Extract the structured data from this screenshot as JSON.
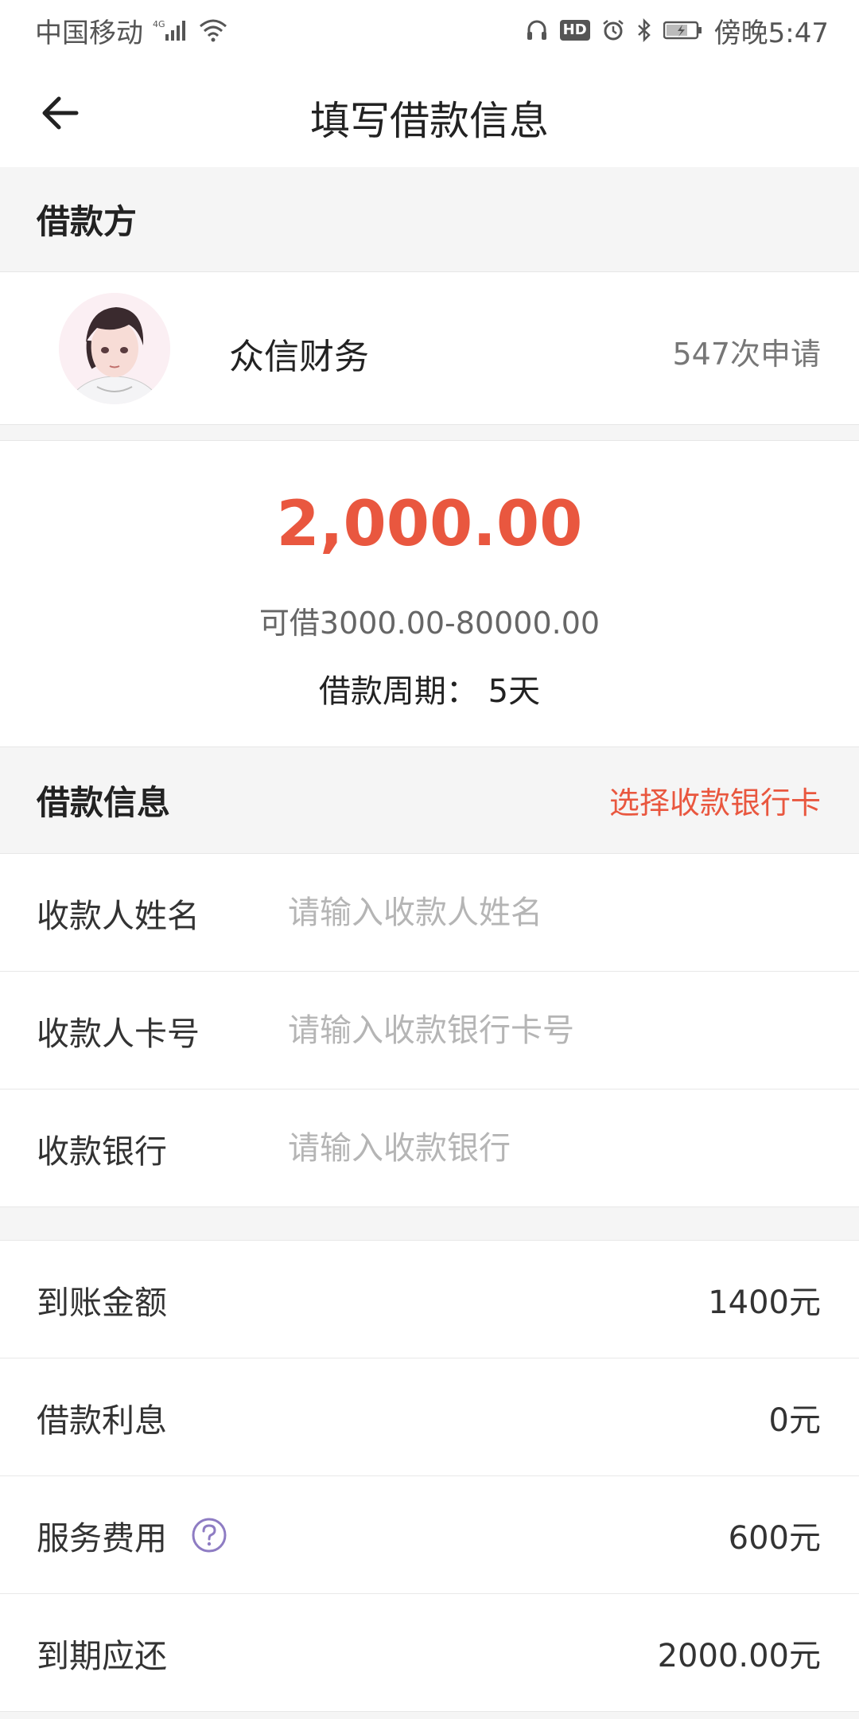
{
  "status_bar": {
    "carrier": "中国移动",
    "network": "4G",
    "hd": "HD",
    "time": "傍晚5:47"
  },
  "header": {
    "title": "填写借款信息"
  },
  "lender_section": {
    "title": "借款方",
    "name": "众信财务",
    "applications": "547次申请"
  },
  "amount": {
    "value": "2,000.00",
    "range": "可借3000.00-80000.00",
    "period": "借款周期：  5天"
  },
  "loan_info": {
    "title": "借款信息",
    "select_card": "选择收款银行卡",
    "fields": [
      {
        "label": "收款人姓名",
        "value": "",
        "placeholder": "请输入收款人姓名"
      },
      {
        "label": "收款人卡号",
        "value": "",
        "placeholder": "请输入收款银行卡号"
      },
      {
        "label": "收款银行",
        "value": "",
        "placeholder": "请输入收款银行"
      }
    ]
  },
  "summary": [
    {
      "label": "到账金额",
      "value": "1400元"
    },
    {
      "label": "借款利息",
      "value": "0元"
    },
    {
      "label": "服务费用",
      "value": "600元"
    },
    {
      "label": "到期应还",
      "value": "2000.00元"
    }
  ],
  "colors": {
    "accent": "#e9573f",
    "help_icon": "#8e7cc3",
    "background": "#f5f5f5"
  },
  "icons": {
    "back": "arrow-left-icon",
    "help": "question-circle-icon"
  }
}
